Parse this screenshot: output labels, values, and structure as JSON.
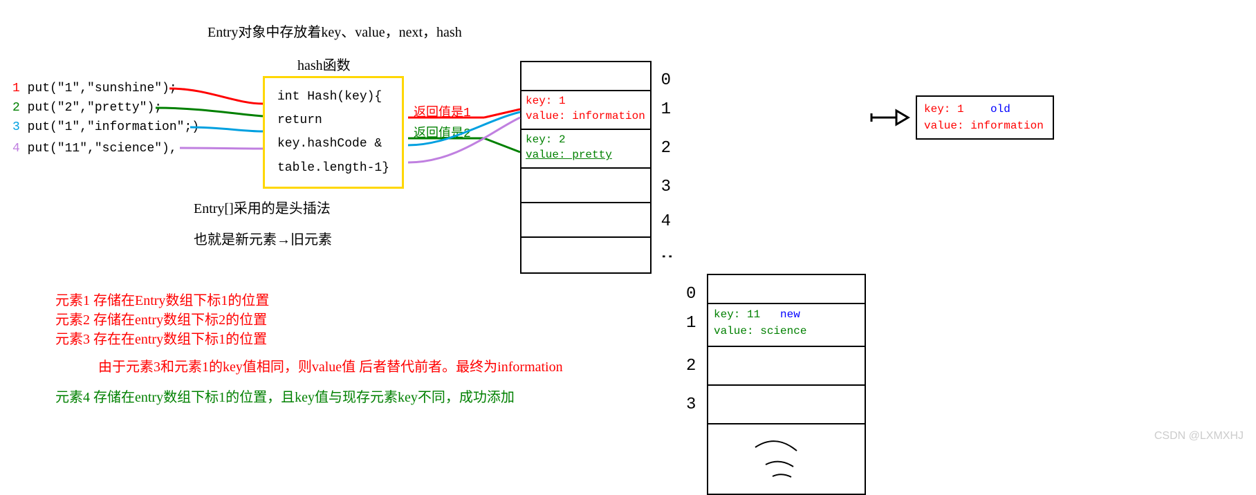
{
  "header": {
    "title": "Entry对象中存放着key、value，next，hash",
    "hash_label": "hash函数"
  },
  "puts": [
    {
      "num": "1",
      "code": "put(\"1\",\"sunshine\");",
      "num_color": "#ff0000"
    },
    {
      "num": "2",
      "code": "put(\"2\",\"pretty\");",
      "num_color": "#008000"
    },
    {
      "num": "3",
      "code": "put(\"1\",\"information\";)",
      "num_color": "#00a0e0"
    },
    {
      "num": "4",
      "code": "put(\"11\",\"science\"),",
      "num_color": "#c080e0"
    }
  ],
  "hash_box": "int Hash(key){\nreturn\nkey.hashCode &\ntable.length-1}",
  "return_labels": {
    "r1": "返回值是1",
    "r2": "返回值是2"
  },
  "table1": {
    "cell1_key": "key: 1",
    "cell1_value": "value: information",
    "cell2_key": "key: 2",
    "cell2_value": "value: pretty",
    "idx0": "0",
    "idx1": "1",
    "idx2": "2",
    "idx3": "3",
    "idx4": "4",
    "dots": ":"
  },
  "table2": {
    "cell1_key": "key: 11",
    "cell1_value": "value: science",
    "cell1_tag": "new",
    "idx0": "0",
    "idx1": "1",
    "idx2": "2",
    "idx3": "3"
  },
  "old_box": {
    "key": "key: 1",
    "value": "value: information",
    "tag": "old"
  },
  "notes": {
    "n1": "Entry[]采用的是头插法",
    "n2": "也就是新元素→旧元素",
    "e1": "元素1 存储在Entry数组下标1的位置",
    "e2": "元素2 存储在entry数组下标2的位置",
    "e3": "元素3 存在在entry数组下标1的位置",
    "e3b": "由于元素3和元素1的key值相同，则value值 后者替代前者。最终为information",
    "e4": "元素4 存储在entry数组下标1的位置，且key值与现存元素key不同，成功添加"
  },
  "watermark": "CSDN @LXMXHJ"
}
